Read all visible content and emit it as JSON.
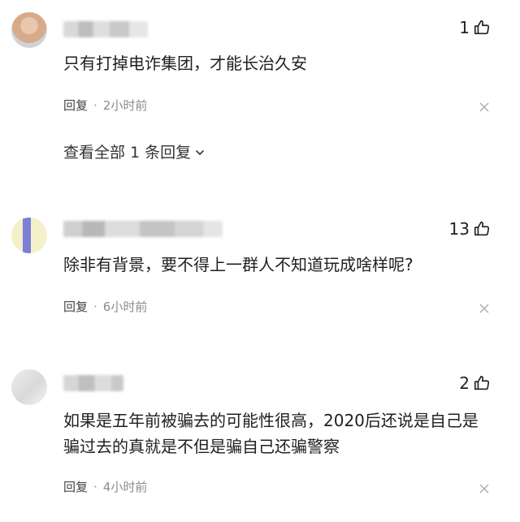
{
  "comments": [
    {
      "like_count": "1",
      "text": "只有打掉电诈集团，才能长治久安",
      "reply_label": "回复",
      "separator": "·",
      "time": "2小时前",
      "view_all_label": "查看全部 1 条回复"
    },
    {
      "like_count": "13",
      "text": "除非有背景，要不得上一群人不知道玩成啥样呢?",
      "reply_label": "回复",
      "separator": "·",
      "time": "6小时前"
    },
    {
      "like_count": "2",
      "text": "如果是五年前被骗去的可能性很高，2020后还说是自己是骗过去的真就是不但是骗自己还骗警察",
      "reply_label": "回复",
      "separator": "·",
      "time": "4小时前"
    }
  ],
  "colors": {
    "text": "#1f1f1f",
    "meta": "#8b8b8b",
    "background": "#ffffff"
  },
  "icons": {
    "like": "thumbs-up-icon",
    "close": "close-icon",
    "expand": "chevron-down-icon"
  }
}
